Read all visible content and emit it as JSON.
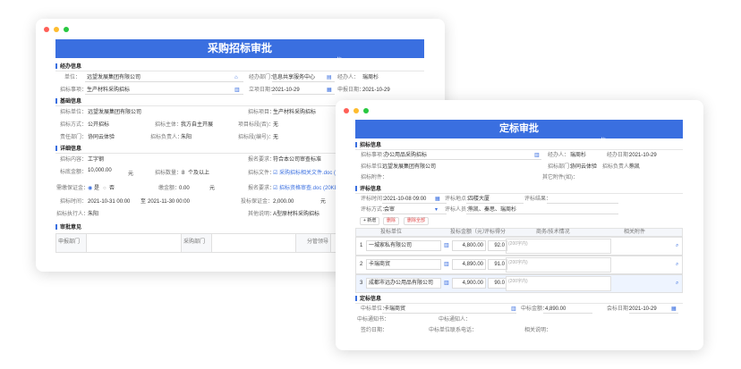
{
  "w1": {
    "title": "采购招标审批",
    "no": "№",
    "s1": "经办信息",
    "unit_l": "单位：",
    "unit_v": "远望发展集团有限公司",
    "dept_l": "经办部门：",
    "dept_v": "信息共享服务中心",
    "agent_l": "经办人：",
    "agent_v": "瑞周杉",
    "matter_l": "招标事项：",
    "matter_v": "生产材料采购招标",
    "date_l": "立项日期：",
    "date_v": "2021-10-29",
    "apply_l": "申报日期：",
    "apply_v": "2021-10-29",
    "s2": "基础信息",
    "bunit_l": "招标单位：",
    "bunit_v": "远望发展集团有限公司",
    "proj_l": "招标项目：",
    "proj_v": "生产材料采购招标",
    "method_l": "招标方式：",
    "method_v": "公开招标",
    "subject_l": "招标主体：",
    "subject_v": "我方自主开展",
    "pcheck_l": "项目标段(否)：",
    "pcheck_v": "无",
    "rdept_l": "责任部门：",
    "rdept_v": "协同云体验",
    "owner_l": "招标负责人：",
    "owner_v": "朱阳",
    "code_l": "招标段(编号)：",
    "code_v": "无",
    "s3": "详细信息",
    "content_l": "招标内容：",
    "content_v": "工字钢",
    "req_l": "报名要求：",
    "req_v": "符合本公司审查标准",
    "amount_l": "标底金额：",
    "amount_v": "10,000.00",
    "amount_u": "元",
    "qty_l": "招标数量：",
    "qty_v": "8",
    "qty_u": "个及以上",
    "file_l": "招标文件：",
    "file_v": "采购招标相关文件.doc (20",
    "bond_l": "需缴保证金：",
    "bond_yes": "是",
    "bond_no": "否",
    "bondamt_l": "缴金额：",
    "bondamt_v": "0.00",
    "bondamt_u": "元",
    "reqfile_l": "报名要求：",
    "reqfile_v": "招标资格审查.doc (20KB",
    "time_l": "招标时间：",
    "time_start": "2021-10-31 00:00",
    "time_to": "至",
    "time_end": "2021-11-30 00:00",
    "deposit_l": "投标保证金：",
    "deposit_v": "2,000.00",
    "deposit_u": "元",
    "exec_l": "招标执行人：",
    "exec_v": "朱阳",
    "other_l": "其他说明：",
    "other_v": "A型原材料采购招标",
    "s4": "审批意见",
    "op1": "申报部门",
    "op2": "采购部门",
    "op3": "分管领导"
  },
  "w2": {
    "title": "定标审批",
    "no": "№",
    "s1": "招标信息",
    "matter_l": "招标事项：",
    "matter_v": "办公用品采购招标",
    "agent_l": "经办人：",
    "agent_v": "瑞周杉",
    "date_l": "经办日期：",
    "date_v": "2021-10-29",
    "unit_l": "招标单位：",
    "unit_v": "远望发展集团有限公司",
    "dept_l": "招标部门：",
    "dept_v": "协同云体验",
    "owner_l": "招标负责人：",
    "owner_v": "熊凯",
    "attach_l": "招标附件：",
    "other_l": "其它附件(如)：",
    "s2": "评标信息",
    "etime_l": "评标时间：",
    "etime_v": "2021-10-08 09:00",
    "eplace_l": "评标地点：",
    "eplace_v": "四楼大厦",
    "eresult_l": "评标结果：",
    "emethod_l": "评标方式：",
    "emethod_v": "会审",
    "epeople_l": "评标人员：",
    "epeople_v": "熊凯、秦思、瑞周杉",
    "btn_add": "+ 新增",
    "btn_del": "删除",
    "btn_delall": "删除全部",
    "cols": [
      "投标单位",
      "投标金额（元）",
      "评标得分",
      "商务/技术情况",
      "相关附件"
    ],
    "rows": [
      {
        "n": "1",
        "unit": "一城家私有限公司",
        "amt": "4,800.00",
        "score": "92.0"
      },
      {
        "n": "2",
        "unit": "卡瑞商贸",
        "amt": "4,890.00",
        "score": "91.0"
      },
      {
        "n": "3",
        "unit": "成都市远办公用品有限公司",
        "amt": "4,900.00",
        "score": "90.0"
      }
    ],
    "ph": "(200字内)",
    "s3": "定标信息",
    "win_l": "中标单位：",
    "win_v": "卡瑞商贸",
    "winamt_l": "中标金额：",
    "winamt_v": "4,890.00",
    "decide_l": "会标日期：",
    "decide_v": "2021-10-29",
    "notice_l": "中标通知书：",
    "notice2_l": "中标通知人：",
    "contract_l": "签约日期：",
    "contact_l": "中标单位联系电话：",
    "desc_l": "相关说明："
  }
}
